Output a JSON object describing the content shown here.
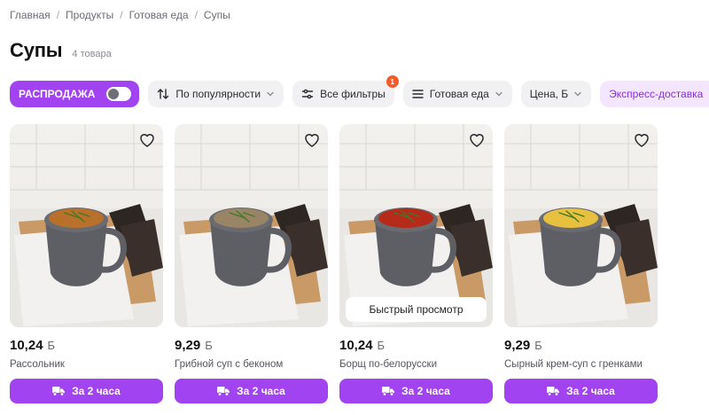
{
  "breadcrumb": [
    "Главная",
    "Продукты",
    "Готовая еда",
    "Супы"
  ],
  "page": {
    "title": "Супы",
    "count": "4 товара"
  },
  "filters": {
    "sale_label": "РАСПРОДАЖА",
    "sort_label": "По популярности",
    "all_filters_label": "Все фильтры",
    "all_filters_badge": "1",
    "category_label": "Готовая еда",
    "price_label": "Цена, Б",
    "express_label": "Экспресс-доставка"
  },
  "products": [
    {
      "price": "10,24",
      "currency": "Б",
      "name": "Рассольник",
      "delivery": "За 2 часа",
      "soup_color": "#b9702a"
    },
    {
      "price": "9,29",
      "currency": "Б",
      "name": "Грибной суп с беконом",
      "delivery": "За 2 часа",
      "soup_color": "#9a8466"
    },
    {
      "price": "10,24",
      "currency": "Б",
      "name": "Борщ по-белорусски",
      "delivery": "За 2 часа",
      "soup_color": "#b62a1a",
      "quick_view": "Быстрый просмотр"
    },
    {
      "price": "9,29",
      "currency": "Б",
      "name": "Сырный крем-суп с гренками",
      "delivery": "За 2 часа",
      "soup_color": "#e8c040"
    }
  ],
  "colors": {
    "accent": "#a243f2",
    "badge": "#f25b2a",
    "chip_bg": "#f1f1f4",
    "active_chip_bg": "#f4e6fe"
  }
}
